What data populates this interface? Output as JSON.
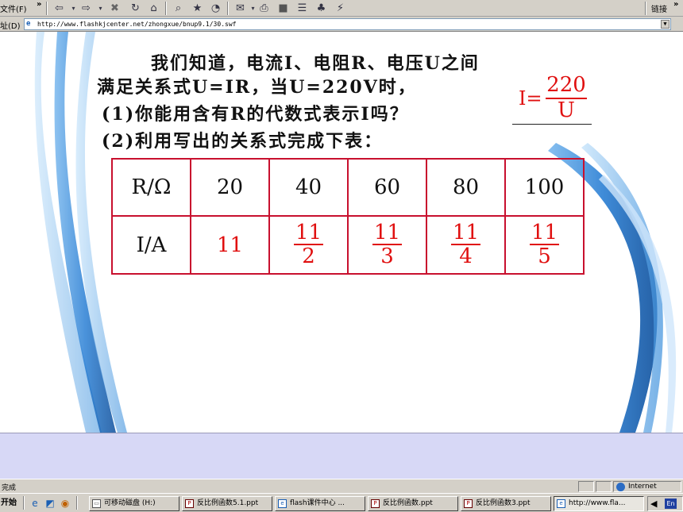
{
  "toolbar": {
    "file_menu": "文件(F)",
    "chevron": "»",
    "links_label": "链接",
    "links_chevron": "»",
    "icons": [
      "back-icon",
      "forward-icon",
      "stop-icon",
      "refresh-icon",
      "home-icon",
      "search-icon",
      "favorites-icon",
      "history-icon",
      "mail-icon",
      "print-icon",
      "edit-icon",
      "discuss-icon",
      "messenger-icon"
    ]
  },
  "addressbar": {
    "label": "址(D)",
    "url": "http://www.flashkjcenter.net/zhongxue/bnup9.1/30.swf"
  },
  "slide": {
    "line1": "我们知道，电流I、电阻R、电压U之间",
    "line2": "满足关系式U=IR，当U=220V时，",
    "line3": "(1)你能用含有R的代数式表示I吗？",
    "line4": "(2)利用写出的关系式完成下表：",
    "answer": {
      "lhs": "I=",
      "numerator": "220",
      "denominator": "U"
    },
    "table": {
      "row1_header": "R/Ω",
      "r_values": [
        "20",
        "40",
        "60",
        "80",
        "100"
      ],
      "row2_header": "I/A",
      "i_first": "11",
      "i_fractions": [
        {
          "num": "11",
          "den": "2"
        },
        {
          "num": "11",
          "den": "3"
        },
        {
          "num": "11",
          "den": "4"
        },
        {
          "num": "11",
          "den": "5"
        }
      ]
    },
    "accent_color": "#e01010",
    "border_color": "#c8102e",
    "swirl_color": "#2a7fd4"
  },
  "statusbar": {
    "text": "完成",
    "zone": "Internet"
  },
  "taskbar": {
    "start": "开始",
    "tasks": [
      {
        "label": "可移动磁盘 (H:)",
        "icon": "drive-icon"
      },
      {
        "label": "反比例函数5.1.ppt",
        "icon": "ppt-icon"
      },
      {
        "label": "flash课件中心 ...",
        "icon": "ie-icon"
      },
      {
        "label": "反比例函数.ppt",
        "icon": "ppt-icon"
      },
      {
        "label": "反比例函数3.ppt",
        "icon": "ppt-icon"
      },
      {
        "label": "http://www.fla...",
        "icon": "ie-icon"
      }
    ],
    "tray_lang": "En"
  }
}
